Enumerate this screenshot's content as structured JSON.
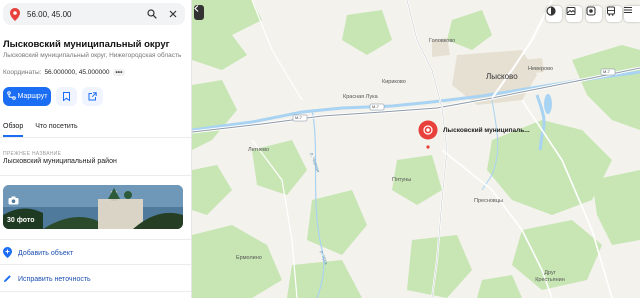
{
  "search": {
    "value": "56.00, 45.00"
  },
  "place": {
    "title": "Лысковский муниципальный округ",
    "subtitle": "Лысковский муниципальный округ, Нижегородская область",
    "coords_label": "Координаты:",
    "coords_value": "56.000000, 45.000000",
    "coords_more": "•••"
  },
  "actions": {
    "route_label": "Маршрут"
  },
  "tabs": [
    {
      "label": "Обзор",
      "active": true
    },
    {
      "label": "Что посетить",
      "active": false
    }
  ],
  "former_name": {
    "label": "ПРЕЖНЕЕ НАЗВАНИЕ",
    "value": "Лысковский муниципальный район"
  },
  "photos": {
    "count_label": "30 фото"
  },
  "links": [
    {
      "label": "Добавить объект"
    },
    {
      "label": "Исправить неточность"
    }
  ],
  "map": {
    "poi_label": "Лысковский муниципаль...",
    "places": [
      "Головково",
      "Кириково",
      "Лысково",
      "Неверово",
      "Красная Лука",
      "Летнево",
      "Пятуны",
      "Пресновцы",
      "Ермолино",
      "Друг Крестьянин"
    ],
    "road_labels": [
      "М-7",
      "М-7",
      "М-7"
    ],
    "river_labels": [
      "р. Черная",
      "р. Урга"
    ]
  },
  "colors": {
    "accent": "#1b6ef3",
    "poi": "#e8403a",
    "forest": "#c7e6b4",
    "water": "#a9d3f2"
  }
}
